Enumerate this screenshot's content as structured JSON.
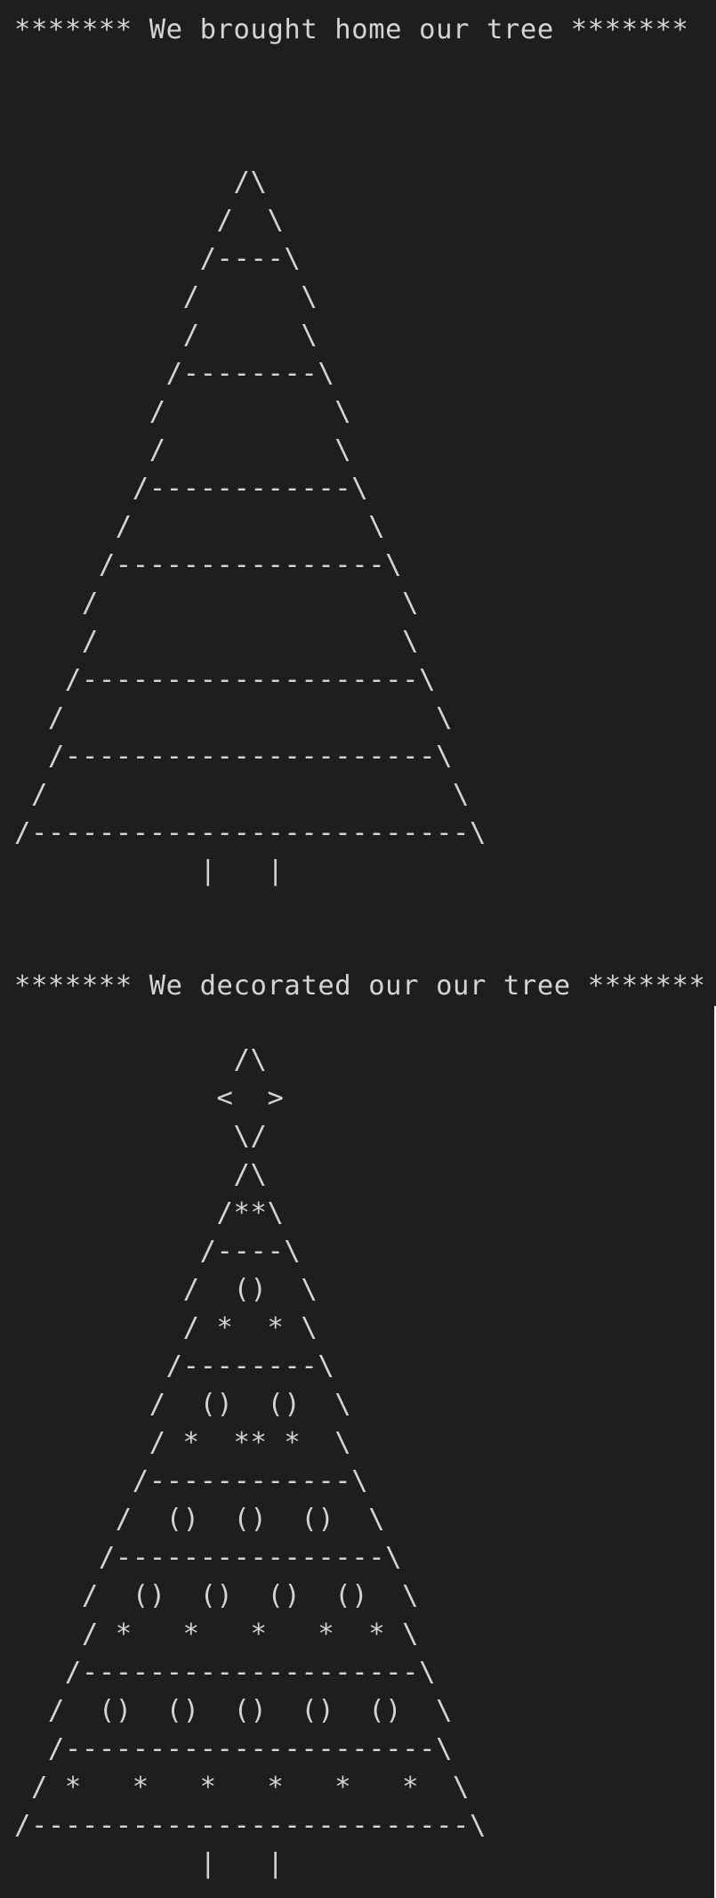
{
  "sections": [
    {
      "heading": "******* We brought home our tree *******",
      "tree_lines": [
        "             /\\",
        "            /  \\",
        "           /----\\",
        "          /      \\",
        "          /      \\",
        "         /--------\\",
        "        /          \\",
        "        /          \\",
        "       /------------\\",
        "      /              \\",
        "     /----------------\\",
        "    /                  \\",
        "    /                  \\",
        "   /--------------------\\",
        "  /                      \\",
        "  /----------------------\\",
        " /                        \\",
        "/--------------------------\\",
        "           |   |"
      ]
    },
    {
      "heading": "******* We decorated our our tree *******",
      "tree_lines": [
        "             /\\",
        "            <  >",
        "             \\/",
        "             /\\",
        "            /**\\",
        "           /----\\",
        "          /  ()  \\",
        "          / *  * \\",
        "         /--------\\",
        "        /  ()  ()  \\",
        "        / *  ** *  \\",
        "       /------------\\",
        "      /  ()  ()  ()  \\",
        "     /----------------\\",
        "    /  ()  ()  ()  ()  \\",
        "    / *   *   *   *  * \\",
        "   /--------------------\\",
        "  /  ()  ()  ()  ()  ()  \\",
        "  /----------------------\\",
        " / *   *   *   *   *   *  \\",
        "/--------------------------\\",
        "           |   |"
      ]
    }
  ]
}
